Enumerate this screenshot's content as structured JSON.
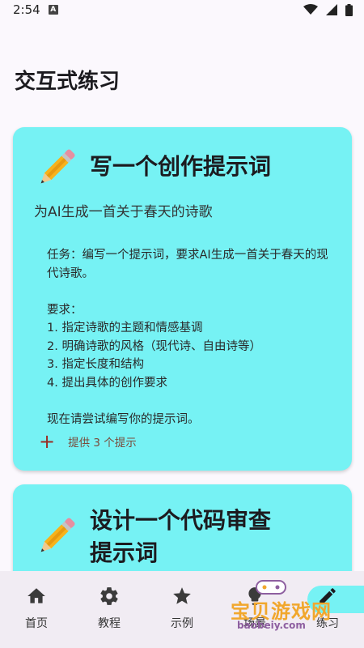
{
  "status_bar": {
    "time": "2:54",
    "notification_letter": "A"
  },
  "page": {
    "title": "交互式练习"
  },
  "cards": [
    {
      "icon": "pencil-icon",
      "title": "写一个创作提示词",
      "subtitle": "为AI生成一首关于春天的诗歌",
      "task": "任务：编写一个提示词，要求AI生成一首关于春天的现代诗歌。\n\n要求：\n1. 指定诗歌的主题和情感基调\n2. 明确诗歌的风格（现代诗、自由诗等）\n3. 指定长度和结构\n4. 提出具体的创作要求\n\n现在请尝试编写你的提示词。",
      "hint_label": "提供 3 个提示"
    },
    {
      "icon": "pencil-icon",
      "title": "设计一个代码审查提示词"
    }
  ],
  "bottom_nav": {
    "items": [
      {
        "label": "首页",
        "icon": "home-icon"
      },
      {
        "label": "教程",
        "icon": "gear-icon"
      },
      {
        "label": "示例",
        "icon": "star-icon"
      },
      {
        "label": "场景",
        "icon": "lightbulb-icon"
      },
      {
        "label": "练习",
        "icon": "edit-icon",
        "active": true
      }
    ]
  },
  "watermark": {
    "text": "宝贝游戏网",
    "url": "baobeiy.com"
  },
  "colors": {
    "card": "#76f2f4",
    "background": "#fbf8fd",
    "nav_background": "#f1ecf3",
    "hint_plus": "#9a2d24"
  }
}
